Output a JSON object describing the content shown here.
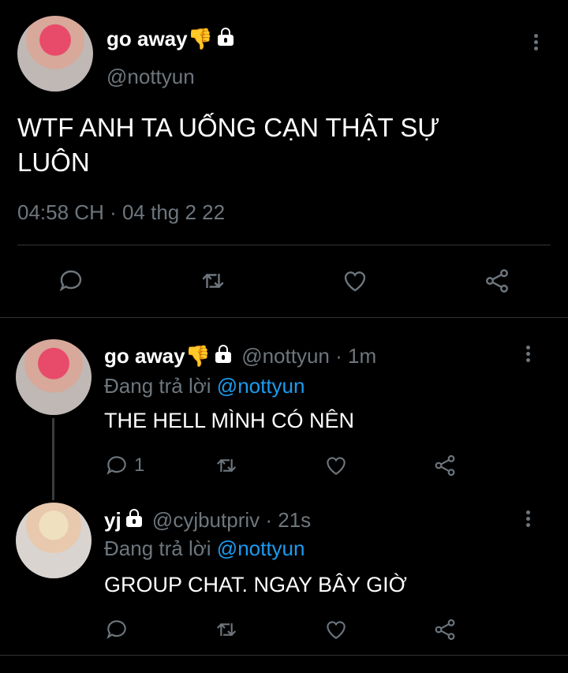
{
  "main_tweet": {
    "display_name": "go away",
    "emoji": "👎",
    "handle": "@nottyun",
    "text_line1": "WTF ANH TA UỐNG CẠN THẬT SỰ",
    "text_line2": "LUÔN",
    "timestamp": "04:58 CH · 04 thg 2 22"
  },
  "reply1": {
    "display_name": "go away",
    "emoji": "👎",
    "handle": "@nottyun",
    "time": "· 1m",
    "replying_label": "Đang trả lời",
    "replying_to": "@nottyun",
    "text": "THE HELL MÌNH CÓ NÊN",
    "reply_count": "1"
  },
  "reply2": {
    "display_name": "yj",
    "handle": "@cyjbutpriv",
    "time": "· 21s",
    "replying_label": "Đang trả lời",
    "replying_to": "@nottyun",
    "text": "GROUP CHAT. NGAY BÂY GIỜ"
  },
  "icons": {
    "reply": "comment-icon",
    "retweet": "retweet-icon",
    "like": "heart-icon",
    "share": "share-icon",
    "more": "more-vertical-icon",
    "lock": "lock-icon"
  },
  "colors": {
    "background": "#000000",
    "muted": "#6e767d",
    "link": "#1d9bf0",
    "icon": "#6e767d"
  }
}
